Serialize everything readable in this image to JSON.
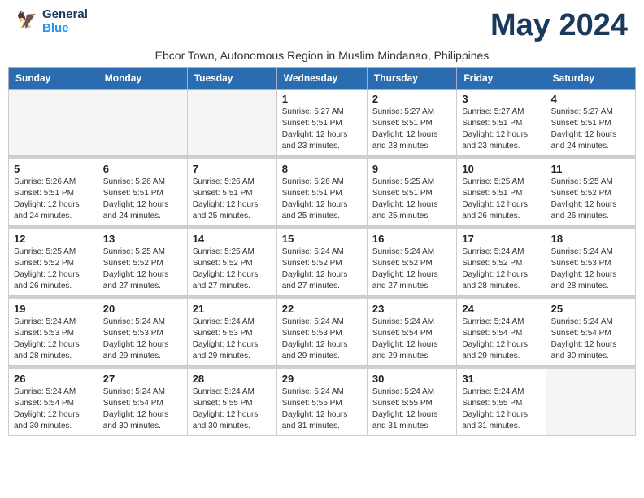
{
  "header": {
    "logo_line1": "General",
    "logo_line2": "Blue",
    "month_year": "May 2024",
    "location": "Ebcor Town, Autonomous Region in Muslim Mindanao, Philippines"
  },
  "days_of_week": [
    "Sunday",
    "Monday",
    "Tuesday",
    "Wednesday",
    "Thursday",
    "Friday",
    "Saturday"
  ],
  "weeks": [
    {
      "days": [
        {
          "num": "",
          "sunrise": "",
          "sunset": "",
          "daylight": "",
          "empty": true
        },
        {
          "num": "",
          "sunrise": "",
          "sunset": "",
          "daylight": "",
          "empty": true
        },
        {
          "num": "",
          "sunrise": "",
          "sunset": "",
          "daylight": "",
          "empty": true
        },
        {
          "num": "1",
          "sunrise": "Sunrise: 5:27 AM",
          "sunset": "Sunset: 5:51 PM",
          "daylight": "Daylight: 12 hours and 23 minutes.",
          "empty": false
        },
        {
          "num": "2",
          "sunrise": "Sunrise: 5:27 AM",
          "sunset": "Sunset: 5:51 PM",
          "daylight": "Daylight: 12 hours and 23 minutes.",
          "empty": false
        },
        {
          "num": "3",
          "sunrise": "Sunrise: 5:27 AM",
          "sunset": "Sunset: 5:51 PM",
          "daylight": "Daylight: 12 hours and 23 minutes.",
          "empty": false
        },
        {
          "num": "4",
          "sunrise": "Sunrise: 5:27 AM",
          "sunset": "Sunset: 5:51 PM",
          "daylight": "Daylight: 12 hours and 24 minutes.",
          "empty": false
        }
      ]
    },
    {
      "days": [
        {
          "num": "5",
          "sunrise": "Sunrise: 5:26 AM",
          "sunset": "Sunset: 5:51 PM",
          "daylight": "Daylight: 12 hours and 24 minutes.",
          "empty": false
        },
        {
          "num": "6",
          "sunrise": "Sunrise: 5:26 AM",
          "sunset": "Sunset: 5:51 PM",
          "daylight": "Daylight: 12 hours and 24 minutes.",
          "empty": false
        },
        {
          "num": "7",
          "sunrise": "Sunrise: 5:26 AM",
          "sunset": "Sunset: 5:51 PM",
          "daylight": "Daylight: 12 hours and 25 minutes.",
          "empty": false
        },
        {
          "num": "8",
          "sunrise": "Sunrise: 5:26 AM",
          "sunset": "Sunset: 5:51 PM",
          "daylight": "Daylight: 12 hours and 25 minutes.",
          "empty": false
        },
        {
          "num": "9",
          "sunrise": "Sunrise: 5:25 AM",
          "sunset": "Sunset: 5:51 PM",
          "daylight": "Daylight: 12 hours and 25 minutes.",
          "empty": false
        },
        {
          "num": "10",
          "sunrise": "Sunrise: 5:25 AM",
          "sunset": "Sunset: 5:51 PM",
          "daylight": "Daylight: 12 hours and 26 minutes.",
          "empty": false
        },
        {
          "num": "11",
          "sunrise": "Sunrise: 5:25 AM",
          "sunset": "Sunset: 5:52 PM",
          "daylight": "Daylight: 12 hours and 26 minutes.",
          "empty": false
        }
      ]
    },
    {
      "days": [
        {
          "num": "12",
          "sunrise": "Sunrise: 5:25 AM",
          "sunset": "Sunset: 5:52 PM",
          "daylight": "Daylight: 12 hours and 26 minutes.",
          "empty": false
        },
        {
          "num": "13",
          "sunrise": "Sunrise: 5:25 AM",
          "sunset": "Sunset: 5:52 PM",
          "daylight": "Daylight: 12 hours and 27 minutes.",
          "empty": false
        },
        {
          "num": "14",
          "sunrise": "Sunrise: 5:25 AM",
          "sunset": "Sunset: 5:52 PM",
          "daylight": "Daylight: 12 hours and 27 minutes.",
          "empty": false
        },
        {
          "num": "15",
          "sunrise": "Sunrise: 5:24 AM",
          "sunset": "Sunset: 5:52 PM",
          "daylight": "Daylight: 12 hours and 27 minutes.",
          "empty": false
        },
        {
          "num": "16",
          "sunrise": "Sunrise: 5:24 AM",
          "sunset": "Sunset: 5:52 PM",
          "daylight": "Daylight: 12 hours and 27 minutes.",
          "empty": false
        },
        {
          "num": "17",
          "sunrise": "Sunrise: 5:24 AM",
          "sunset": "Sunset: 5:52 PM",
          "daylight": "Daylight: 12 hours and 28 minutes.",
          "empty": false
        },
        {
          "num": "18",
          "sunrise": "Sunrise: 5:24 AM",
          "sunset": "Sunset: 5:53 PM",
          "daylight": "Daylight: 12 hours and 28 minutes.",
          "empty": false
        }
      ]
    },
    {
      "days": [
        {
          "num": "19",
          "sunrise": "Sunrise: 5:24 AM",
          "sunset": "Sunset: 5:53 PM",
          "daylight": "Daylight: 12 hours and 28 minutes.",
          "empty": false
        },
        {
          "num": "20",
          "sunrise": "Sunrise: 5:24 AM",
          "sunset": "Sunset: 5:53 PM",
          "daylight": "Daylight: 12 hours and 29 minutes.",
          "empty": false
        },
        {
          "num": "21",
          "sunrise": "Sunrise: 5:24 AM",
          "sunset": "Sunset: 5:53 PM",
          "daylight": "Daylight: 12 hours and 29 minutes.",
          "empty": false
        },
        {
          "num": "22",
          "sunrise": "Sunrise: 5:24 AM",
          "sunset": "Sunset: 5:53 PM",
          "daylight": "Daylight: 12 hours and 29 minutes.",
          "empty": false
        },
        {
          "num": "23",
          "sunrise": "Sunrise: 5:24 AM",
          "sunset": "Sunset: 5:54 PM",
          "daylight": "Daylight: 12 hours and 29 minutes.",
          "empty": false
        },
        {
          "num": "24",
          "sunrise": "Sunrise: 5:24 AM",
          "sunset": "Sunset: 5:54 PM",
          "daylight": "Daylight: 12 hours and 29 minutes.",
          "empty": false
        },
        {
          "num": "25",
          "sunrise": "Sunrise: 5:24 AM",
          "sunset": "Sunset: 5:54 PM",
          "daylight": "Daylight: 12 hours and 30 minutes.",
          "empty": false
        }
      ]
    },
    {
      "days": [
        {
          "num": "26",
          "sunrise": "Sunrise: 5:24 AM",
          "sunset": "Sunset: 5:54 PM",
          "daylight": "Daylight: 12 hours and 30 minutes.",
          "empty": false
        },
        {
          "num": "27",
          "sunrise": "Sunrise: 5:24 AM",
          "sunset": "Sunset: 5:54 PM",
          "daylight": "Daylight: 12 hours and 30 minutes.",
          "empty": false
        },
        {
          "num": "28",
          "sunrise": "Sunrise: 5:24 AM",
          "sunset": "Sunset: 5:55 PM",
          "daylight": "Daylight: 12 hours and 30 minutes.",
          "empty": false
        },
        {
          "num": "29",
          "sunrise": "Sunrise: 5:24 AM",
          "sunset": "Sunset: 5:55 PM",
          "daylight": "Daylight: 12 hours and 31 minutes.",
          "empty": false
        },
        {
          "num": "30",
          "sunrise": "Sunrise: 5:24 AM",
          "sunset": "Sunset: 5:55 PM",
          "daylight": "Daylight: 12 hours and 31 minutes.",
          "empty": false
        },
        {
          "num": "31",
          "sunrise": "Sunrise: 5:24 AM",
          "sunset": "Sunset: 5:55 PM",
          "daylight": "Daylight: 12 hours and 31 minutes.",
          "empty": false
        },
        {
          "num": "",
          "sunrise": "",
          "sunset": "",
          "daylight": "",
          "empty": true
        }
      ]
    }
  ]
}
